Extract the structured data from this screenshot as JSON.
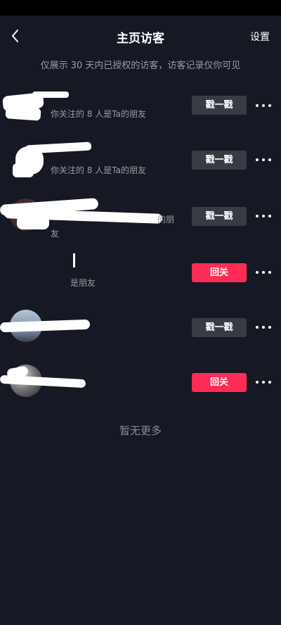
{
  "header": {
    "title": "主页访客",
    "settings_label": "设置",
    "back_icon": "chevron-left-icon"
  },
  "notice": "仅展示 30 天内已授权的访客，访客记录仅你可见",
  "visitors": [
    {
      "subtitle": "你关注的 8 人是Ta的朋友",
      "action": "戳一戳"
    },
    {
      "subtitle": "你关注的 8 人是Ta的朋友",
      "action": "戳一戳"
    },
    {
      "subtitle": "的朋",
      "subtitle2": "友",
      "action": "戳一戳"
    },
    {
      "subtitle": "是朋友",
      "action": "回关"
    },
    {
      "subtitle": "",
      "action": "戳一戳"
    },
    {
      "subtitle": "",
      "action": "回关"
    }
  ],
  "footer": "暂无更多",
  "colors": {
    "background": "#161823",
    "poke_button": "#393b44",
    "follow_button": "#fe2c55",
    "secondary_text": "#9a9ba3"
  }
}
